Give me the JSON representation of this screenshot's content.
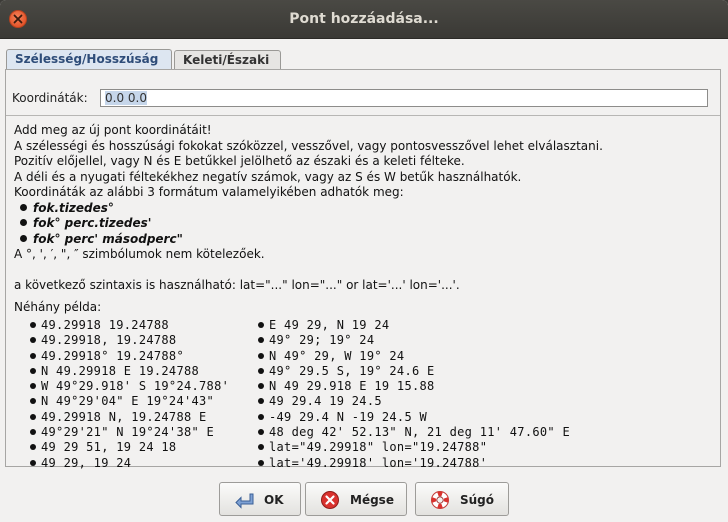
{
  "window": {
    "title": "Pont hozzáadása..."
  },
  "tabs": [
    {
      "label": "Szélesség/Hosszúság",
      "active": true
    },
    {
      "label": "Keleti/Északi",
      "active": false
    }
  ],
  "coordinates": {
    "label": "Koordináták:",
    "value": "0.0 0.0"
  },
  "help": {
    "intro": "Add meg az új pont koordinátáit!",
    "line1": "A szélességi és hosszúsági fokokat szóközzel, vesszővel, vagy pontosvesszővel lehet elválasztani.",
    "line2": "Pozitív előjellel, vagy N és E betűkkel jelölhető az északi és a keleti félteke.",
    "line3": "A déli és a nyugati féltekékhez negatív számok, vagy az S és W betűk használhatók.",
    "formats_intro": "Koordináták az alábbi 3 formátum valamelyikében adhatók meg:",
    "formats": [
      "fok.tizedes°",
      "fok° perc.tizedes'",
      "fok° perc' másodperc\""
    ],
    "symbols_note": "A °, ', ′, \", ″ szimbólumok nem kötelezőek.",
    "syntax_note": "a következő szintaxis is használható: lat=\"...\" lon=\"...\" or lat='...' lon='...'."
  },
  "examples": {
    "heading": "Néhány példa:",
    "left": [
      "49.29918 19.24788",
      "49.29918, 19.24788",
      "49.29918° 19.24788°",
      "N 49.29918 E 19.24788",
      "W 49°29.918' S 19°24.788'",
      "N 49°29'04\" E 19°24'43\"",
      "49.29918 N, 19.24788 E",
      "49°29'21\" N 19°24'38\" E",
      "49 29 51, 19 24 18",
      "49 29, 19 24"
    ],
    "right": [
      "E 49 29, N 19 24",
      "49° 29; 19° 24",
      "N 49° 29, W 19° 24",
      "49° 29.5 S, 19° 24.6 E",
      "N 49 29.918 E 19 15.88",
      "49 29.4 19 24.5",
      "-49 29.4 N -19 24.5 W",
      "48 deg 42' 52.13\" N, 21 deg 11' 47.60\" E",
      "lat=\"49.29918\" lon=\"19.24788\"",
      "lat='49.29918' lon='19.24788'"
    ]
  },
  "buttons": {
    "ok": "OK",
    "cancel": "Mégse",
    "help": "Súgó"
  },
  "colors": {
    "titlebar": "#3c3b37",
    "close": "#e95420",
    "tab_active": "#dde6f1"
  }
}
